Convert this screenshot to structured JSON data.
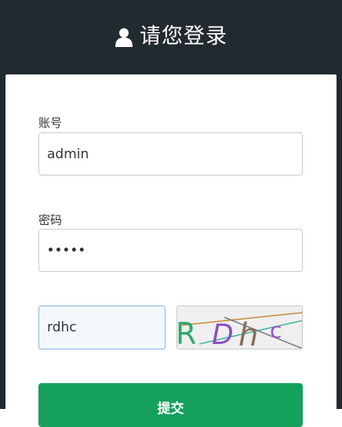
{
  "header": {
    "icon": "user-icon",
    "title": "请您登录"
  },
  "form": {
    "account_label": "账号",
    "account_value": "admin",
    "password_label": "密码",
    "password_value": "•••••",
    "captcha_value": "rdhc",
    "captcha_image_text": "RDhc",
    "submit_label": "提交"
  },
  "colors": {
    "header_bg": "#212a2f",
    "submit_bg": "#16a05d"
  }
}
